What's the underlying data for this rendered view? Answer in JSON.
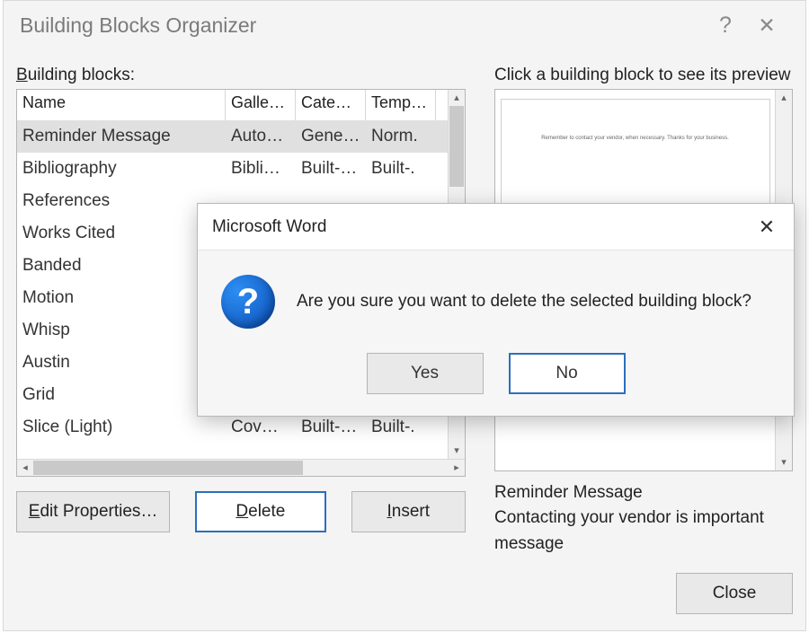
{
  "dialog": {
    "title": "Building Blocks Organizer",
    "help_glyph": "?",
    "close_glyph": "✕"
  },
  "left": {
    "label": "Building blocks:",
    "columns": {
      "name": "Name",
      "gallery": "Galle…",
      "category": "Cate…",
      "template": "Temp…"
    },
    "rows": [
      {
        "name": "Reminder Message",
        "gallery": "Auto…",
        "category": "Gene…",
        "template": "Norm.",
        "selected": true
      },
      {
        "name": "Bibliography",
        "gallery": "Bibli…",
        "category": "Built-…",
        "template": "Built-."
      },
      {
        "name": "References",
        "gallery": "",
        "category": "",
        "template": ""
      },
      {
        "name": "Works Cited",
        "gallery": "",
        "category": "",
        "template": ""
      },
      {
        "name": "Banded",
        "gallery": "",
        "category": "",
        "template": ""
      },
      {
        "name": "Motion",
        "gallery": "",
        "category": "",
        "template": ""
      },
      {
        "name": "Whisp",
        "gallery": "",
        "category": "",
        "template": ""
      },
      {
        "name": "Austin",
        "gallery": "",
        "category": "",
        "template": ""
      },
      {
        "name": "Grid",
        "gallery": "",
        "category": "",
        "template": ""
      },
      {
        "name": "Slice (Light)",
        "gallery": "Cov…",
        "category": "Built-…",
        "template": "Built-."
      }
    ],
    "buttons": {
      "edit_props": "Edit Properties…",
      "delete": "Delete",
      "insert": "Insert"
    }
  },
  "right": {
    "label": "Click a building block to see its preview",
    "preview_text": "Remember to contact your vendor, when necessary. Thanks for your business.",
    "preview_name": "Reminder Message",
    "preview_desc": "Contacting your vendor is important message",
    "close": "Close"
  },
  "modal": {
    "title": "Microsoft Word",
    "message": "Are you sure you want to delete the selected building block?",
    "yes": "Yes",
    "no": "No"
  }
}
